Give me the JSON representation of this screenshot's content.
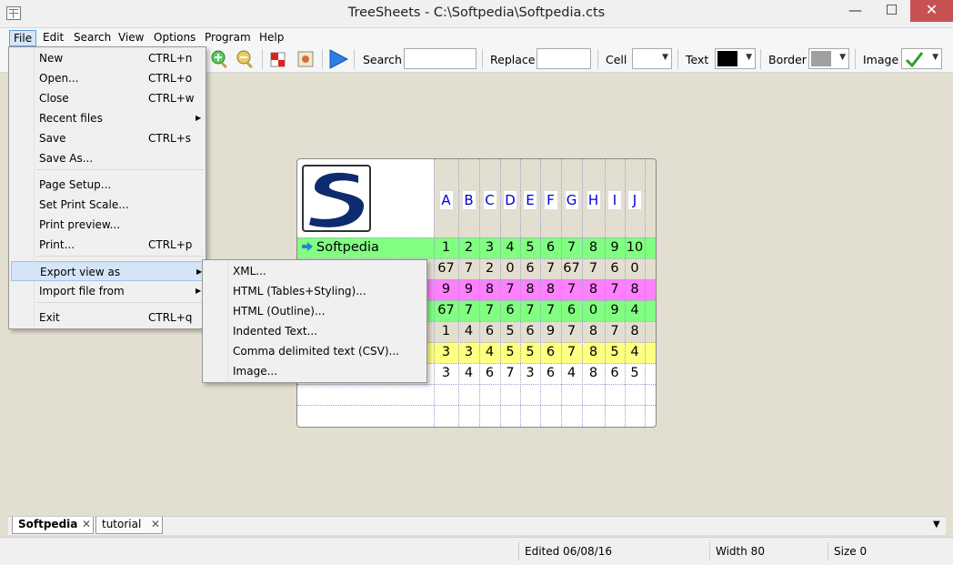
{
  "window": {
    "title": "TreeSheets - C:\\Softpedia\\Softpedia.cts",
    "minimize_glyph": "—",
    "maximize_glyph": "☐",
    "close_glyph": "✕"
  },
  "menubar": [
    "File",
    "Edit",
    "Search",
    "View",
    "Options",
    "Program",
    "Help"
  ],
  "toolbar": {
    "search_label": "Search",
    "search_value": "",
    "replace_label": "Replace",
    "replace_value": "",
    "cell_label": "Cell",
    "text_label": "Text",
    "text_color": "#000000",
    "border_label": "Border",
    "border_color": "#a0a0a0",
    "image_label": "Image",
    "icons": [
      "zoom-in-icon",
      "zoom-out-icon",
      "flag-icon",
      "image-icon",
      "play-icon",
      "checkmark-icon"
    ]
  },
  "file_menu": {
    "items": [
      {
        "label": "New",
        "shortcut": "CTRL+n"
      },
      {
        "label": "Open...",
        "shortcut": "CTRL+o"
      },
      {
        "label": "Close",
        "shortcut": "CTRL+w"
      },
      {
        "label": "Recent files",
        "submenu": "▶"
      },
      {
        "label": "Save",
        "shortcut": "CTRL+s"
      },
      {
        "label": "Save As..."
      },
      {
        "label": "Page Setup..."
      },
      {
        "label": "Set Print Scale..."
      },
      {
        "label": "Print preview..."
      },
      {
        "label": "Print...",
        "shortcut": "CTRL+p"
      },
      {
        "label": "Export view as",
        "submenu": "▶"
      },
      {
        "label": "Import file from",
        "submenu": "▶"
      },
      {
        "label": "Exit",
        "shortcut": "CTRL+q"
      }
    ]
  },
  "export_submenu": {
    "items": [
      "XML...",
      "HTML (Tables+Styling)...",
      "HTML (Outline)...",
      "Indented Text...",
      "Comma delimited text (CSV)...",
      "Image..."
    ]
  },
  "sheet": {
    "logo_letter": "S",
    "columns": [
      "A",
      "B",
      "C",
      "D",
      "E",
      "F",
      "G",
      "H",
      "I",
      "J"
    ],
    "rows": [
      {
        "label": "Softpedia",
        "bg": "#80ff80",
        "values": [
          "1",
          "2",
          "3",
          "4",
          "5",
          "6",
          "7",
          "8",
          "9",
          "10"
        ]
      },
      {
        "label": "",
        "bg": "#e3dfd0",
        "values": [
          "67",
          "7",
          "2",
          "0",
          "6",
          "7",
          "67",
          "7",
          "6",
          "0"
        ]
      },
      {
        "label": "",
        "bg": "#ff80ff",
        "values": [
          "9",
          "9",
          "8",
          "7",
          "8",
          "8",
          "7",
          "8",
          "7",
          "8"
        ]
      },
      {
        "label": "",
        "bg": "#80ff80",
        "values": [
          "67",
          "7",
          "7",
          "6",
          "7",
          "7",
          "6",
          "0",
          "9",
          "4"
        ]
      },
      {
        "label": "",
        "bg": "#e3dfd0",
        "values": [
          "1",
          "4",
          "6",
          "5",
          "6",
          "9",
          "7",
          "8",
          "7",
          "8"
        ]
      },
      {
        "label": "",
        "bg": "#ffff80",
        "values": [
          "3",
          "3",
          "4",
          "5",
          "5",
          "6",
          "7",
          "8",
          "5",
          "4"
        ]
      },
      {
        "label": "",
        "bg": "#ffffff",
        "values": [
          "3",
          "4",
          "6",
          "7",
          "3",
          "6",
          "4",
          "8",
          "6",
          "5"
        ]
      }
    ]
  },
  "tabs": [
    {
      "label": "Softpedia",
      "close": "✕"
    },
    {
      "label": "tutorial",
      "close": "✕"
    }
  ],
  "tab_scroll_glyph": "▼",
  "status": {
    "edited": "Edited 06/08/16",
    "width": "Width 80",
    "size": "Size 0"
  }
}
